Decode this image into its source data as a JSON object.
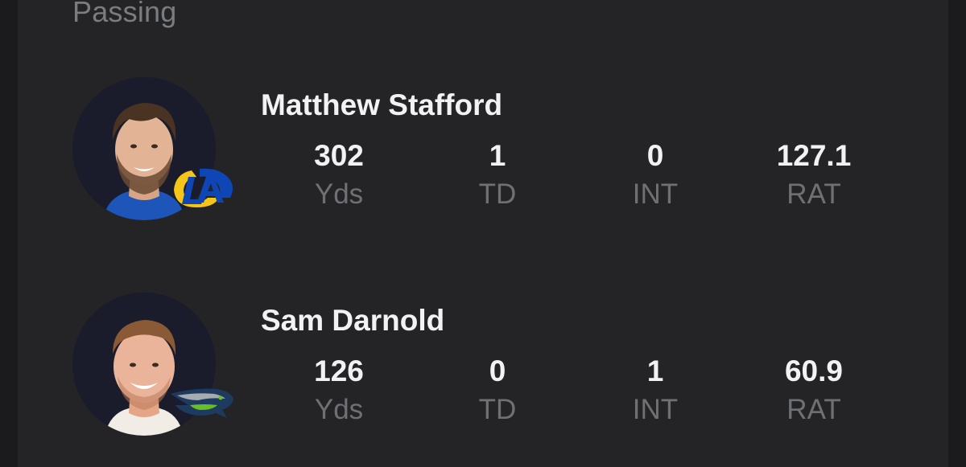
{
  "section": {
    "title": "Passing"
  },
  "players": [
    {
      "name": "Matthew Stafford",
      "team_logo": "rams-logo",
      "stats": {
        "yds": {
          "value": "302",
          "label": "Yds"
        },
        "td": {
          "value": "1",
          "label": "TD"
        },
        "int": {
          "value": "0",
          "label": "INT"
        },
        "rat": {
          "value": "127.1",
          "label": "RAT"
        }
      }
    },
    {
      "name": "Sam Darnold",
      "team_logo": "seahawks-logo",
      "stats": {
        "yds": {
          "value": "126",
          "label": "Yds"
        },
        "td": {
          "value": "0",
          "label": "TD"
        },
        "int": {
          "value": "1",
          "label": "INT"
        },
        "rat": {
          "value": "60.9",
          "label": "RAT"
        }
      }
    }
  ],
  "colors": {
    "background": "#1b1b1d",
    "card": "#242426",
    "headshot_bg": "#1a1c2b",
    "primary_text": "#f2f2f4",
    "secondary_text": "#6f7074",
    "rams_blue": "#0e47b5",
    "rams_gold": "#f5c518",
    "seahawks_navy": "#1f3a5f",
    "seahawks_green": "#69be28"
  }
}
